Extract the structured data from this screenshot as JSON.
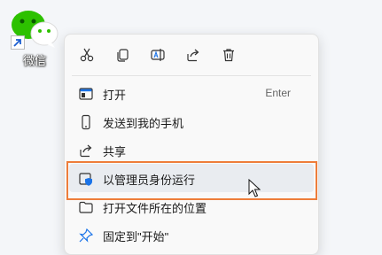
{
  "desktop": {
    "icon_label": "微信",
    "icon_name": "wechat-icon"
  },
  "toolbar": {
    "buttons": [
      {
        "name": "cut",
        "icon": "scissors-icon"
      },
      {
        "name": "copy",
        "icon": "copy-icon"
      },
      {
        "name": "rename",
        "icon": "rename-icon"
      },
      {
        "name": "share",
        "icon": "share-icon"
      },
      {
        "name": "delete",
        "icon": "trash-icon"
      }
    ]
  },
  "menu": {
    "items": [
      {
        "label": "打开",
        "shortcut": "Enter",
        "icon": "open-window-icon"
      },
      {
        "label": "发送到我的手机",
        "shortcut": "",
        "icon": "phone-icon"
      },
      {
        "label": "共享",
        "shortcut": "",
        "icon": "share-icon"
      },
      {
        "label": "以管理员身份运行",
        "shortcut": "",
        "icon": "admin-shield-icon"
      },
      {
        "label": "打开文件所在的位置",
        "shortcut": "",
        "icon": "folder-icon"
      },
      {
        "label": "固定到\"开始\"",
        "shortcut": "",
        "icon": "pin-icon"
      }
    ]
  },
  "colors": {
    "highlight_border": "#ee7d3a",
    "wechat_green": "#2dc100",
    "shield_blue": "#1a73e8"
  }
}
